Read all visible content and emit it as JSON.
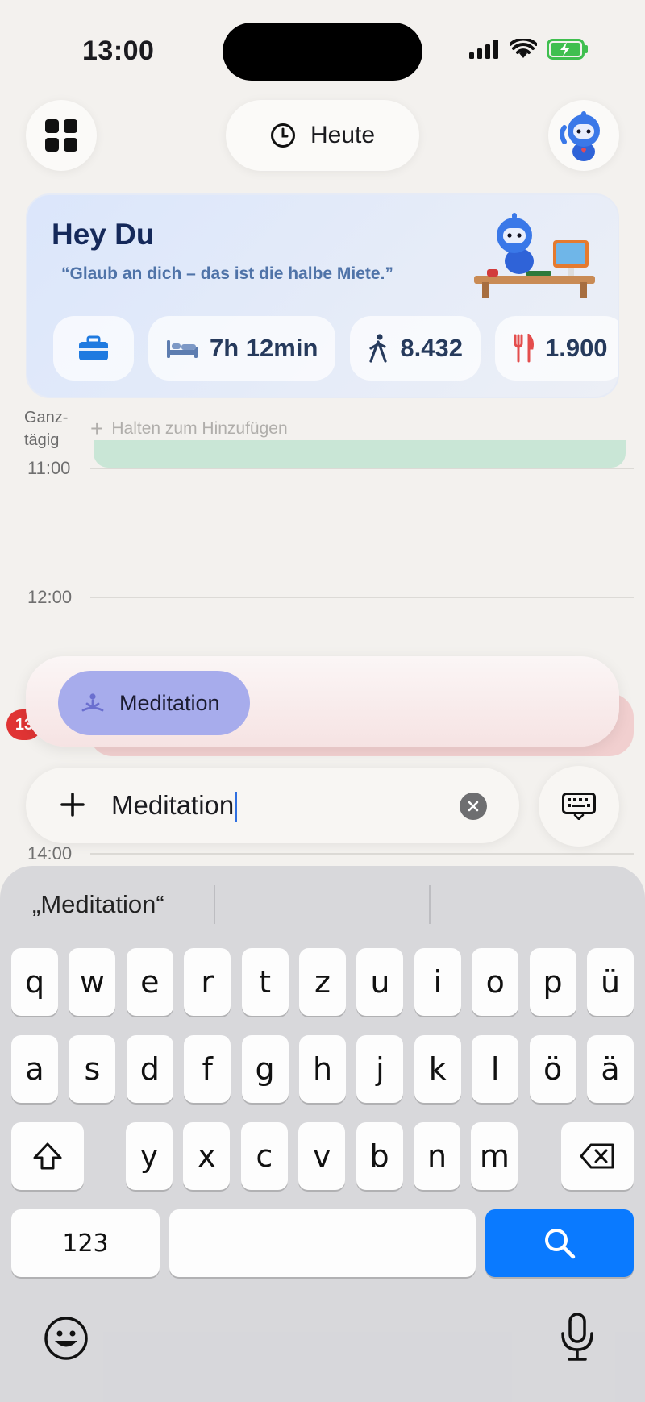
{
  "status_bar": {
    "time": "13:00"
  },
  "header": {
    "today_label": "Heute"
  },
  "hero": {
    "greeting": "Hey Du",
    "quote": "“Glaub an dich – das ist die halbe Miete.”",
    "stats": [
      {
        "icon": "sleep-bed-icon",
        "value": "7h 12min"
      },
      {
        "icon": "walking-icon",
        "value": "8.432"
      },
      {
        "icon": "fork-knife-icon",
        "value": "1.900"
      }
    ]
  },
  "calendar": {
    "allday_label": "Ganz-\ntägig",
    "hold_hint": "Halten zum Hinzufügen",
    "hours": [
      "11:00",
      "12:00",
      "14:00"
    ],
    "badge": "13"
  },
  "drag_event": {
    "label": "Meditation",
    "icon": "meditation-icon"
  },
  "input": {
    "value": "Meditation"
  },
  "keyboard": {
    "suggestion": "„Meditation“",
    "row1": [
      "q",
      "w",
      "e",
      "r",
      "t",
      "z",
      "u",
      "i",
      "o",
      "p",
      "ü"
    ],
    "row2": [
      "a",
      "s",
      "d",
      "f",
      "g",
      "h",
      "j",
      "k",
      "l",
      "ö",
      "ä"
    ],
    "row3": [
      "y",
      "x",
      "c",
      "v",
      "b",
      "n",
      "m"
    ],
    "numbers_key": "123"
  },
  "colors": {
    "accent_blue": "#0a7aff",
    "meditation_chip": "#a7acec",
    "hero_bg": "#dbe6fb",
    "red_badge": "#e03434"
  }
}
